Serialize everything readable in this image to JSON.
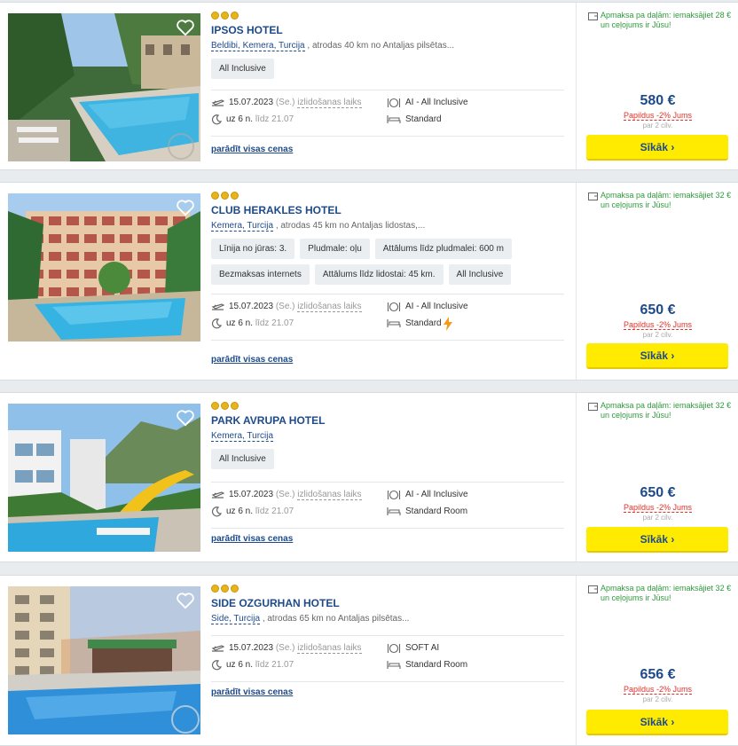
{
  "common": {
    "price_note": "Papildus -2% Jums",
    "per_person": "par 2 cilv.",
    "details_label": "Sīkāk",
    "show_prices_label": "parādīt visas cenas",
    "departure_suffix": "(Se.)",
    "departure_label": "izlidošanas laiks",
    "duration": "uz 6 n.",
    "until": "līdz 21.07",
    "date": "15.07.2023"
  },
  "hotels": [
    {
      "stars": 3,
      "name": "IPSOS HOTEL",
      "location": "Beldibi, Kemera, Turcija",
      "distance": ", atrodas 40 km no Antaljas pilsētas...",
      "tags": [
        "All Inclusive"
      ],
      "meal": "AI - All Inclusive",
      "room": "Standard",
      "payment": "Apmaksa pa daļām: iemaksājiet 28 € un ceļojums ir Jūsu!",
      "price": "580 €",
      "photo_theme": "pool"
    },
    {
      "stars": 3,
      "name": "CLUB HERAKLES HOTEL",
      "location": "Kemera, Turcija",
      "distance": ", atrodas 45 km no Antaljas lidostas,...",
      "tags": [
        "Līnija no jūras: 3.",
        "Pludmale: oļu",
        "Attālums līdz pludmalei: 600 m",
        "Bezmaksas internets",
        "Attālums līdz lidostai: 45 km.",
        "All Inclusive"
      ],
      "meal": "AI - All Inclusive",
      "room": "Standard",
      "payment": "Apmaksa pa daļām: iemaksājiet 32 € un ceļojums ir Jūsu!",
      "price": "650 €",
      "photo_theme": "building"
    },
    {
      "stars": 3,
      "name": "PARK AVRUPA HOTEL",
      "location": "Kemera, Turcija",
      "distance": "",
      "tags": [
        "All Inclusive"
      ],
      "meal": "AI - All Inclusive",
      "room": "Standard Room",
      "payment": "Apmaksa pa daļām: iemaksājiet 32 € un ceļojums ir Jūsu!",
      "price": "650 €",
      "photo_theme": "slide"
    },
    {
      "stars": 3,
      "name": "SIDE OZGURHAN HOTEL",
      "location": "Side, Turcija",
      "distance": ", atrodas 65 km no Antaljas pilsētas...",
      "tags": [],
      "meal": "SOFT AI",
      "room": "Standard Room",
      "payment": "Apmaksa pa daļām: iemaksājiet 32 € un ceļojums ir Jūsu!",
      "price": "656 €",
      "photo_theme": "evening"
    }
  ]
}
